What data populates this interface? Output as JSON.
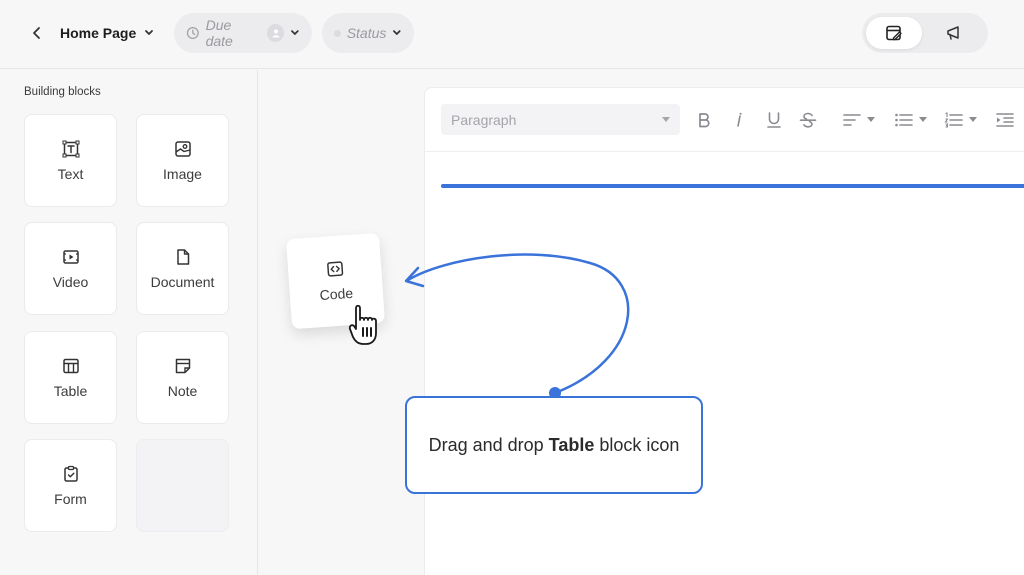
{
  "header": {
    "page_name": "Home Page",
    "due_date_label": "Due date",
    "status_label": "Status"
  },
  "sidebar": {
    "title": "Building blocks",
    "blocks": [
      {
        "label": "Text",
        "icon": "text-icon"
      },
      {
        "label": "Image",
        "icon": "image-icon"
      },
      {
        "label": "Video",
        "icon": "video-icon"
      },
      {
        "label": "Document",
        "icon": "document-icon"
      },
      {
        "label": "Table",
        "icon": "table-icon"
      },
      {
        "label": "Note",
        "icon": "note-icon"
      },
      {
        "label": "Form",
        "icon": "form-icon"
      }
    ]
  },
  "dragging_block": {
    "label": "Code",
    "icon": "code-icon"
  },
  "editor": {
    "paragraph_style": "Paragraph"
  },
  "callout": {
    "text_before": "Drag and drop ",
    "text_bold": "Table",
    "text_after": " block icon"
  },
  "colors": {
    "accent": "#3a73d9",
    "background": "#f7f7f8"
  }
}
